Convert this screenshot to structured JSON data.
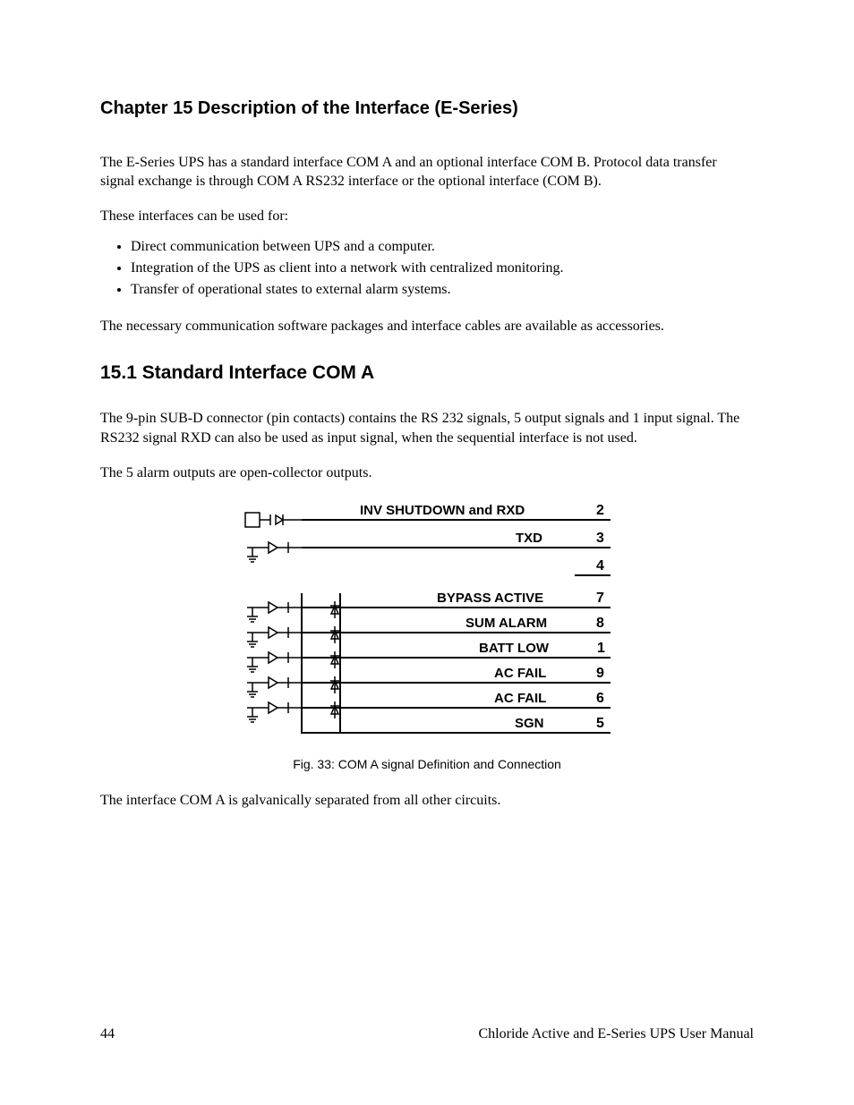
{
  "chapter": {
    "title": "Chapter 15  Description of the Interface (E-Series)"
  },
  "para1": "The E-Series UPS has a standard interface COM A and an optional interface COM B. Protocol data transfer signal exchange is through COM A RS232 interface or the optional interface (COM B).",
  "para2": "These interfaces can be used for:",
  "bullets": [
    "Direct communication between UPS and a computer.",
    "Integration of the UPS as client into a network with centralized monitoring.",
    "Transfer of operational states to external alarm systems."
  ],
  "para3": "The necessary communication software packages and interface cables are available as accessories.",
  "section": {
    "title": "15.1  Standard Interface COM A"
  },
  "para4": "The 9-pin SUB-D connector (pin contacts) contains the RS 232 signals, 5 output signals and 1 input signal. The RS232 signal RXD can also be used as input signal, when the sequential interface is not used.",
  "para5": "The 5 alarm outputs are open-collector outputs.",
  "figure": {
    "caption": "Fig. 33: COM A signal Definition and Connection",
    "signals": [
      {
        "label": "INV SHUTDOWN and RXD",
        "pin": "2"
      },
      {
        "label": "TXD",
        "pin": "3"
      },
      {
        "label": "",
        "pin": "4"
      },
      {
        "label": "BYPASS ACTIVE",
        "pin": "7"
      },
      {
        "label": "SUM ALARM",
        "pin": "8"
      },
      {
        "label": "BATT LOW",
        "pin": "1"
      },
      {
        "label": "AC FAIL",
        "pin": "9"
      },
      {
        "label": "AC FAIL",
        "pin": "6"
      },
      {
        "label": "SGN",
        "pin": "5"
      }
    ]
  },
  "para6": "The interface COM A is galvanically separated from all other circuits.",
  "footer": {
    "page": "44",
    "manual": "Chloride Active and E-Series UPS User Manual"
  }
}
